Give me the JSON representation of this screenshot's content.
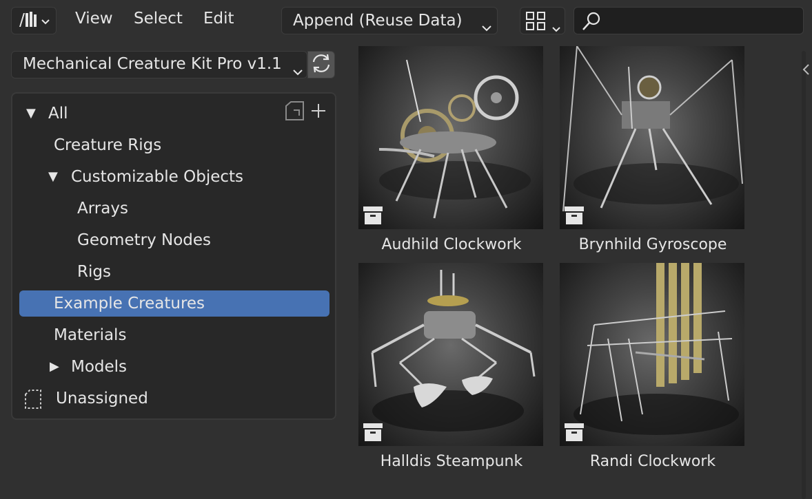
{
  "header": {
    "editor_type_icon": "asset-browser-icon",
    "menus": [
      "View",
      "Select",
      "Edit"
    ],
    "import_method": "Append (Reuse Data)",
    "display_icon": "grid-view-icon",
    "search": {
      "value": "",
      "placeholder": ""
    }
  },
  "library": {
    "selected": "Mechanical Creature Kit Pro v1.1",
    "refresh_icon": "refresh-icon"
  },
  "catalog": {
    "root": "All",
    "items": [
      {
        "label": "Creature Rigs"
      },
      {
        "label": "Customizable Objects"
      },
      {
        "label": "Arrays"
      },
      {
        "label": "Geometry Nodes"
      },
      {
        "label": "Rigs"
      },
      {
        "label": "Example Creatures"
      },
      {
        "label": "Materials"
      },
      {
        "label": "Models"
      },
      {
        "label": "Unassigned"
      }
    ],
    "selected": "Example Creatures"
  },
  "assets": [
    {
      "name": "Audhild Clockwork",
      "badge_icon": "asset-archive-icon"
    },
    {
      "name": "Brynhild Gyroscope",
      "badge_icon": "asset-archive-icon"
    },
    {
      "name": "Halldis Steampunk",
      "badge_icon": "asset-archive-icon"
    },
    {
      "name": "Randi Clockwork",
      "badge_icon": "asset-archive-icon"
    }
  ],
  "colors": {
    "background": "#303030",
    "panel": "#282828",
    "selection": "#4772b3",
    "text": "#e6e6e6"
  }
}
